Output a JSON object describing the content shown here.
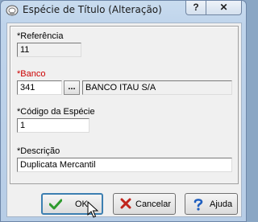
{
  "window": {
    "title": "Espécie de Título (Alteração)",
    "help_label": "?",
    "close_label": "✕"
  },
  "form": {
    "referencia": {
      "label": "*Referência",
      "value": "11"
    },
    "banco": {
      "label": "*Banco",
      "code": "341",
      "lookup_label": "...",
      "name": "BANCO ITAU S/A"
    },
    "codigo_especie": {
      "label": "*Código da Espécie",
      "value": "1"
    },
    "descricao": {
      "label": "*Descrição",
      "value": "Duplicata Mercantil"
    }
  },
  "buttons": {
    "ok": "OK",
    "cancelar": "Cancelar",
    "ajuda": "Ajuda"
  },
  "colors": {
    "required_label": "#cc0000",
    "ok_icon": "#2e9b2e",
    "cancel_icon": "#c0241c",
    "help_icon": "#1f5fbf"
  }
}
